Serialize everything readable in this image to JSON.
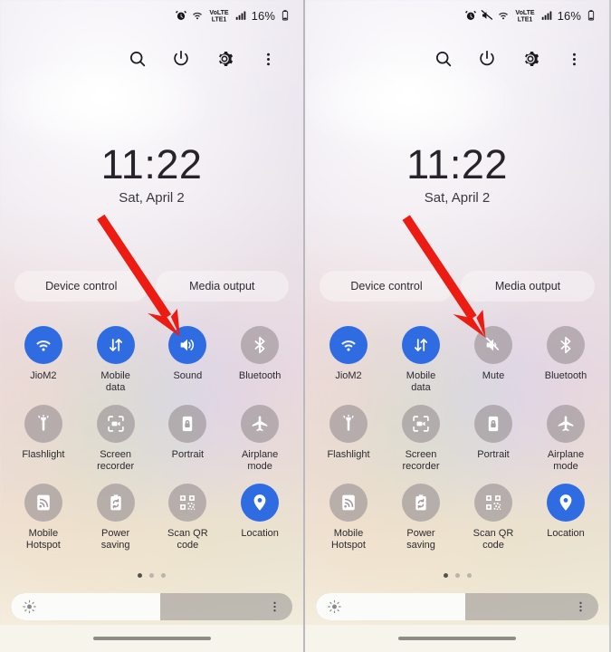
{
  "meta": {
    "accent_blue": "#2f6ce2",
    "inactive_gray": "rgba(151,143,147,0.62)",
    "annotation_red": "#ec1c13"
  },
  "panels": [
    {
      "id": "left",
      "statusbar": {
        "icons": [
          "alarm-icon",
          "wifi-icon",
          "volte-icon",
          "signal-icon"
        ],
        "battery_percent": "16%",
        "battery_icon": "battery-icon"
      },
      "header": {
        "buttons": [
          {
            "name": "search-button",
            "icon": "search-icon"
          },
          {
            "name": "power-button",
            "icon": "power-icon"
          },
          {
            "name": "settings-button",
            "icon": "gear-icon"
          },
          {
            "name": "more-options-button",
            "icon": "overflow-menu-icon"
          }
        ]
      },
      "clock": {
        "time": "11:22",
        "date": "Sat, April 2"
      },
      "pills": [
        {
          "name": "device-control-button",
          "label": "Device control"
        },
        {
          "name": "media-output-button",
          "label": "Media output"
        }
      ],
      "tiles": [
        {
          "name": "tile-wifi",
          "label": "JioM2",
          "icon": "wifi-icon",
          "active": true
        },
        {
          "name": "tile-mobile-data",
          "label": "Mobile\ndata",
          "icon": "mobile-data-icon",
          "active": true
        },
        {
          "name": "tile-sound",
          "label": "Sound",
          "icon": "speaker-icon",
          "active": true
        },
        {
          "name": "tile-bluetooth",
          "label": "Bluetooth",
          "icon": "bluetooth-icon",
          "active": false
        },
        {
          "name": "tile-flashlight",
          "label": "Flashlight",
          "icon": "flashlight-icon",
          "active": false
        },
        {
          "name": "tile-screen-recorder",
          "label": "Screen\nrecorder",
          "icon": "screen-record-icon",
          "active": false
        },
        {
          "name": "tile-portrait",
          "label": "Portrait",
          "icon": "rotation-lock-icon",
          "active": false
        },
        {
          "name": "tile-airplane-mode",
          "label": "Airplane\nmode",
          "icon": "airplane-icon",
          "active": false
        },
        {
          "name": "tile-mobile-hotspot",
          "label": "Mobile\nHotspot",
          "icon": "hotspot-icon",
          "active": false
        },
        {
          "name": "tile-power-saving",
          "label": "Power\nsaving",
          "icon": "power-saving-icon",
          "active": false
        },
        {
          "name": "tile-scan-qr-code",
          "label": "Scan QR\ncode",
          "icon": "qr-code-icon",
          "active": false
        },
        {
          "name": "tile-location",
          "label": "Location",
          "icon": "location-pin-icon",
          "active": true
        }
      ],
      "page_dots": {
        "count": 3,
        "active_index": 0
      },
      "brightness": {
        "value_percent": 53,
        "icon": "brightness-icon",
        "menu_icon": "overflow-menu-icon"
      },
      "arrow": {
        "target": "tile-sound",
        "color": "#ec1c13"
      }
    },
    {
      "id": "right",
      "statusbar": {
        "icons": [
          "alarm-icon",
          "mute-icon",
          "wifi-icon",
          "volte-icon",
          "signal-icon"
        ],
        "battery_percent": "16%",
        "battery_icon": "battery-icon"
      },
      "header": {
        "buttons": [
          {
            "name": "search-button",
            "icon": "search-icon"
          },
          {
            "name": "power-button",
            "icon": "power-icon"
          },
          {
            "name": "settings-button",
            "icon": "gear-icon"
          },
          {
            "name": "more-options-button",
            "icon": "overflow-menu-icon"
          }
        ]
      },
      "clock": {
        "time": "11:22",
        "date": "Sat, April 2"
      },
      "pills": [
        {
          "name": "device-control-button",
          "label": "Device control"
        },
        {
          "name": "media-output-button",
          "label": "Media output"
        }
      ],
      "tiles": [
        {
          "name": "tile-wifi",
          "label": "JioM2",
          "icon": "wifi-icon",
          "active": true
        },
        {
          "name": "tile-mobile-data",
          "label": "Mobile\ndata",
          "icon": "mobile-data-icon",
          "active": true
        },
        {
          "name": "tile-mute",
          "label": "Mute",
          "icon": "speaker-mute-icon",
          "active": false
        },
        {
          "name": "tile-bluetooth",
          "label": "Bluetooth",
          "icon": "bluetooth-icon",
          "active": false
        },
        {
          "name": "tile-flashlight",
          "label": "Flashlight",
          "icon": "flashlight-icon",
          "active": false
        },
        {
          "name": "tile-screen-recorder",
          "label": "Screen\nrecorder",
          "icon": "screen-record-icon",
          "active": false
        },
        {
          "name": "tile-portrait",
          "label": "Portrait",
          "icon": "rotation-lock-icon",
          "active": false
        },
        {
          "name": "tile-airplane-mode",
          "label": "Airplane\nmode",
          "icon": "airplane-icon",
          "active": false
        },
        {
          "name": "tile-mobile-hotspot",
          "label": "Mobile\nHotspot",
          "icon": "hotspot-icon",
          "active": false
        },
        {
          "name": "tile-power-saving",
          "label": "Power\nsaving",
          "icon": "power-saving-icon",
          "active": false
        },
        {
          "name": "tile-scan-qr-code",
          "label": "Scan QR\ncode",
          "icon": "qr-code-icon",
          "active": false
        },
        {
          "name": "tile-location",
          "label": "Location",
          "icon": "location-pin-icon",
          "active": true
        }
      ],
      "page_dots": {
        "count": 3,
        "active_index": 0
      },
      "brightness": {
        "value_percent": 53,
        "icon": "brightness-icon",
        "menu_icon": "overflow-menu-icon"
      },
      "arrow": {
        "target": "tile-mute",
        "color": "#ec1c13"
      }
    }
  ]
}
